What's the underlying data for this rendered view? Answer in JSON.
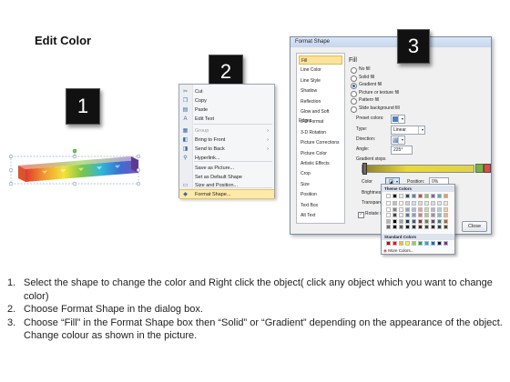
{
  "title": "Edit Color",
  "badges": [
    "1",
    "2",
    "3"
  ],
  "context_menu": {
    "items": [
      {
        "label": "Cut",
        "icon": "scissors-icon",
        "glyph": "✂",
        "disabled": false,
        "submenu": false
      },
      {
        "label": "Copy",
        "icon": "copy-icon",
        "glyph": "❐",
        "disabled": false,
        "submenu": false
      },
      {
        "label": "Paste",
        "icon": "paste-icon",
        "glyph": "▤",
        "disabled": false,
        "submenu": false
      },
      {
        "label": "Edit Text",
        "icon": "edit-text-icon",
        "glyph": "A",
        "disabled": false,
        "submenu": false
      },
      {
        "label": "Group",
        "icon": "group-icon",
        "glyph": "▦",
        "disabled": true,
        "submenu": true
      },
      {
        "label": "Bring to Front",
        "icon": "bring-front-icon",
        "glyph": "◧",
        "disabled": false,
        "submenu": true
      },
      {
        "label": "Send to Back",
        "icon": "send-back-icon",
        "glyph": "◨",
        "disabled": false,
        "submenu": true
      },
      {
        "label": "Hyperlink...",
        "icon": "hyperlink-icon",
        "glyph": "⚲",
        "disabled": false,
        "submenu": false
      },
      {
        "label": "Save as Picture...",
        "icon": "",
        "glyph": "",
        "disabled": false,
        "submenu": false
      },
      {
        "label": "Set as Default Shape",
        "icon": "",
        "glyph": "",
        "disabled": false,
        "submenu": false
      },
      {
        "label": "Size and Position...",
        "icon": "size-position-icon",
        "glyph": "▭",
        "disabled": false,
        "submenu": false
      },
      {
        "label": "Format Shape...",
        "icon": "format-shape-icon",
        "glyph": "◆",
        "disabled": false,
        "submenu": false,
        "highlighted": true
      }
    ]
  },
  "dialog": {
    "title": "Format Shape",
    "sidebar": [
      "Fill",
      "Line Color",
      "Line Style",
      "Shadow",
      "Reflection",
      "Glow and Soft Edges",
      "3-D Format",
      "3-D Rotation",
      "Picture Corrections",
      "Picture Color",
      "Artistic Effects",
      "Crop",
      "Size",
      "Position",
      "Text Box",
      "Alt Text"
    ],
    "fill_heading": "Fill",
    "fill_options": [
      {
        "label": "No fill",
        "checked": false
      },
      {
        "label": "Solid fill",
        "checked": false
      },
      {
        "label": "Gradient fill",
        "checked": true
      },
      {
        "label": "Picture or texture fill",
        "checked": false
      },
      {
        "label": "Pattern fill",
        "checked": false
      },
      {
        "label": "Slide background fill",
        "checked": false
      }
    ],
    "preset_colors_label": "Preset colors:",
    "type_label": "Type:",
    "type_value": "Linear",
    "direction_label": "Direction:",
    "angle_label": "Angle:",
    "angle_value": "225°",
    "gradient_stops_label": "Gradient stops",
    "color_label": "Color",
    "position_label": "Position:",
    "position_value": "0%",
    "brightness_label": "Brightness",
    "transparency_label": "Transpare",
    "rotate_label": "Rotate s",
    "close_button": "Close"
  },
  "palette": {
    "theme_colors_label": "Theme Colors",
    "standard_colors_label": "Standard Colors",
    "more_colors_label": "More Colors...",
    "theme_top": [
      "#ffffff",
      "#000000",
      "#eeece1",
      "#1f497d",
      "#4f81bd",
      "#c0504d",
      "#9bbb59",
      "#8064a2",
      "#4bacc6",
      "#f79646"
    ],
    "standard": [
      "#c00000",
      "#ff0000",
      "#ffc000",
      "#ffff00",
      "#92d050",
      "#00b050",
      "#00b0f0",
      "#0070c0",
      "#002060",
      "#7030a0"
    ]
  },
  "colors": {
    "bar_gradient": [
      "#e03a2f",
      "#f29a2e",
      "#f4e33a",
      "#7cc644",
      "#2fb7d9",
      "#3b6fd1",
      "#7b4fc4"
    ],
    "gradient_bar": [
      "#8a7d2a",
      "#e9d83c",
      "#e0d24a"
    ],
    "highlight": "#fde9a8"
  },
  "instructions": [
    {
      "num": "1.",
      "text": "Select the shape to change the color and Right click the object( click any object which you want to change color)"
    },
    {
      "num": "2.",
      "text": "Choose Format Shape in the dialog box."
    },
    {
      "num": "3.",
      "text": "Choose “Fill” in the Format Shape box then “Solid” or “Gradient” depending on the appearance of the object. Change colour as shown in the picture."
    }
  ]
}
